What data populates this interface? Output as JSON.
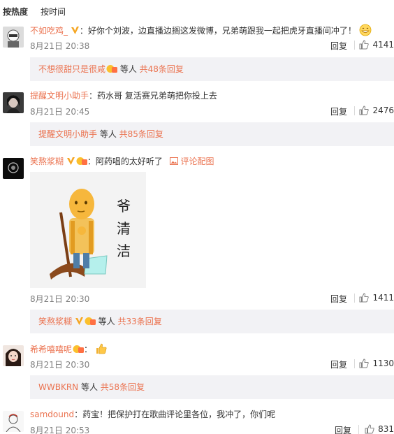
{
  "tabs": [
    {
      "label": "按热度",
      "active": true
    },
    {
      "label": "按时间",
      "active": false
    }
  ],
  "comments": [
    {
      "user": "不如吃鸡_",
      "text": "好你个刘波，边直播边搁这发微博，兄弟萌跟我一起把虎牙直播间冲了！",
      "date": "8月21日 20:38",
      "reply_label": "回复",
      "likes": "4141",
      "reply_summary": {
        "name": "不想很甜只是很咸",
        "etc": " 等人 ",
        "more": "共48条回复"
      }
    },
    {
      "user": "提醒文明小助手",
      "text": "药水哥 复活赛兄弟萌把你投上去",
      "date": "8月21日 20:45",
      "reply_label": "回复",
      "likes": "2476",
      "reply_summary": {
        "name": "提醒文明小助手",
        "etc": " 等人 ",
        "more": "共85条回复"
      }
    },
    {
      "user": "笑熬浆糊",
      "text": "阿药唱的太好听了",
      "pic_link": "评论配图",
      "meme_text": [
        "爷",
        "清",
        "洁"
      ],
      "date": "8月21日 20:30",
      "reply_label": "回复",
      "likes": "1411",
      "reply_summary": {
        "name": "笑熬浆糊",
        "etc": " 等人 ",
        "more": "共33条回复"
      }
    },
    {
      "user": "希希嘻嘻呢",
      "text": "",
      "date": "8月21日 20:30",
      "reply_label": "回复",
      "likes": "1130",
      "reply_summary": {
        "name": "WWBKRN",
        "etc": " 等人 ",
        "more": "共58条回复"
      }
    },
    {
      "user": "samdound",
      "text": "药宝！把保护打在歌曲评论里各位，我冲了，你们呢",
      "date": "8月21日 20:53",
      "reply_label": "回复",
      "likes": "831"
    }
  ],
  "colors": {
    "accent": "#eb7350",
    "reply_bg": "#f2f2f5",
    "vip": "#f5a623"
  },
  "icons": [
    "thumb-up-icon",
    "vip-v-icon",
    "fan-badge-icon",
    "grin-emoji-icon",
    "thumbs-up-emoji-icon",
    "picture-icon"
  ]
}
